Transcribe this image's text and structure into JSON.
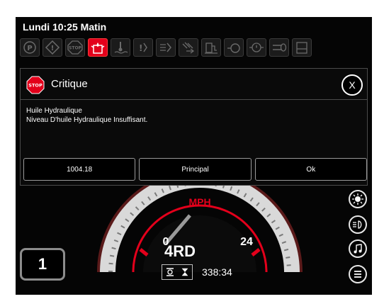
{
  "header": {
    "clock": "Lundi 10:25 Matin"
  },
  "indicators": [
    {
      "icon": "parking-brake-icon",
      "label": "(P)",
      "active": false
    },
    {
      "icon": "warning-icon",
      "label": "!",
      "active": false
    },
    {
      "icon": "stop-icon",
      "label": "STOP",
      "active": false
    },
    {
      "icon": "hydraulic-oil-icon",
      "active": true
    },
    {
      "icon": "coolant-temp-icon",
      "active": false
    },
    {
      "icon": "transmission-fault-icon",
      "active": false
    },
    {
      "icon": "transmission-filter-icon",
      "active": false
    },
    {
      "icon": "air-filter-icon",
      "active": false
    },
    {
      "icon": "fuel-level-icon",
      "active": false
    },
    {
      "icon": "engine-icon",
      "active": false
    },
    {
      "icon": "oil-pressure-icon",
      "active": false
    },
    {
      "icon": "glow-plug-icon",
      "active": false
    },
    {
      "icon": "fuel-tank-icon",
      "active": false
    }
  ],
  "dialog": {
    "badge": "STOP",
    "title": "Critique",
    "line1": "Huile Hydraulique",
    "line2": "Niveau D'huile Hydraulique Insuffisant.",
    "buttons": [
      "1004.18",
      "Principal",
      "Ok"
    ],
    "close": "X"
  },
  "dashboard": {
    "speed_unit": "MPH",
    "speed_min": "0",
    "speed_max": "24",
    "drive_mode": "4RD",
    "gear": "1",
    "hours": "338:34"
  },
  "side_buttons": [
    "light-icon",
    "headlight-icon",
    "music-icon",
    "menu-icon"
  ],
  "colors": {
    "accent": "#e3001b",
    "background": "#050505"
  }
}
